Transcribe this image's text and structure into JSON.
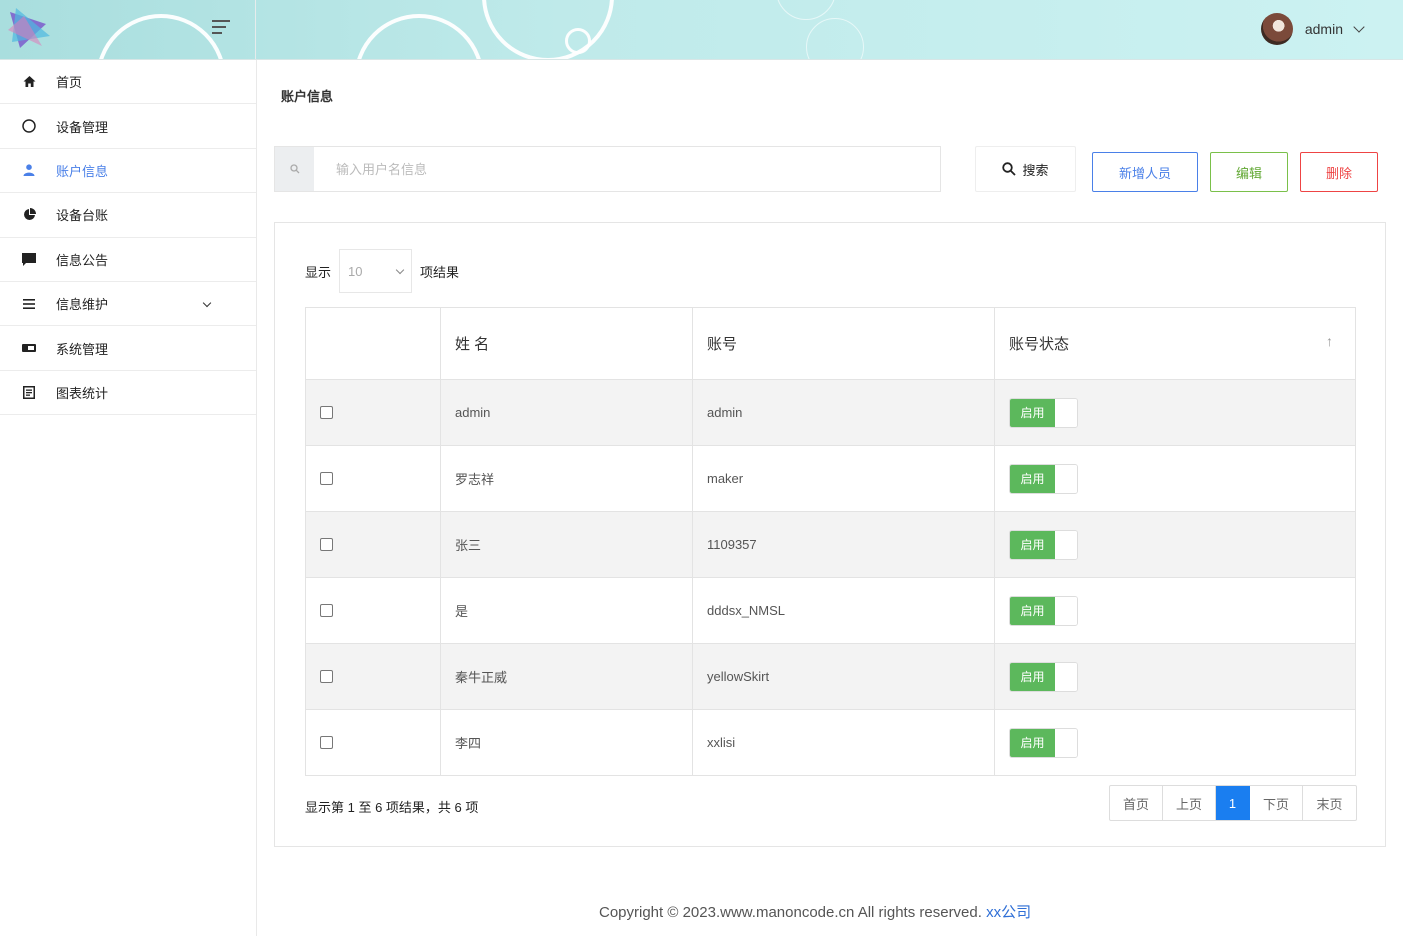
{
  "header": {
    "user_name": "admin"
  },
  "sidebar": {
    "items": [
      {
        "label": "首页",
        "icon": "home-icon"
      },
      {
        "label": "设备管理",
        "icon": "circle-icon"
      },
      {
        "label": "账户信息",
        "icon": "user-icon",
        "active": true
      },
      {
        "label": "设备台账",
        "icon": "pie-chart-icon"
      },
      {
        "label": "信息公告",
        "icon": "comment-icon"
      },
      {
        "label": "信息维护",
        "icon": "list-icon",
        "has_submenu": true
      },
      {
        "label": "系统管理",
        "icon": "id-card-icon"
      },
      {
        "label": "图表统计",
        "icon": "document-icon"
      }
    ]
  },
  "main": {
    "breadcrumb": "账户信息",
    "search": {
      "placeholder": "输入用户名信息",
      "button_label": "搜索"
    },
    "buttons": {
      "add": "新增人员",
      "edit": "编辑",
      "delete": "删除"
    },
    "length": {
      "prefix": "显示",
      "value": "10",
      "suffix": "项结果"
    },
    "table": {
      "headers": [
        "",
        "姓 名",
        "账号",
        "账号状态"
      ],
      "rows": [
        {
          "name": "admin",
          "account": "admin",
          "status": "启用"
        },
        {
          "name": "罗志祥",
          "account": "maker",
          "status": "启用"
        },
        {
          "name": "张三",
          "account": "1109357",
          "status": "启用"
        },
        {
          "name": "是",
          "account": "dddsx_NMSL",
          "status": "启用"
        },
        {
          "name": "秦牛正威",
          "account": "yellowSkirt",
          "status": "启用"
        },
        {
          "name": "李四",
          "account": "xxlisi",
          "status": "启用"
        }
      ]
    },
    "info": "显示第 1 至 6 项结果，共 6 项",
    "pagination": {
      "first": "首页",
      "prev": "上页",
      "current": "1",
      "next": "下页",
      "last": "末页"
    }
  },
  "footer": {
    "copyright": "Copyright © 2023.www.manoncode.cn All rights reserved.",
    "company": "xx公司"
  },
  "colors": {
    "accent": "#4a80e8",
    "success": "#5cb85c",
    "danger": "#ee4444",
    "edit": "#7ac04a",
    "pager_current": "#1a7ef0"
  }
}
